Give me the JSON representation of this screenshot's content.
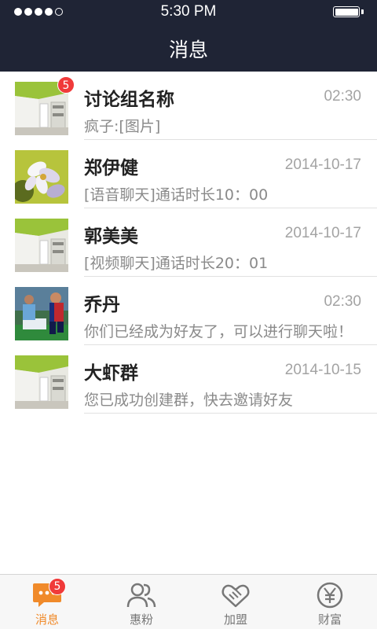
{
  "status_bar": {
    "time": "5:30 PM",
    "signal_dots_filled": 4,
    "signal_dots_total": 5,
    "battery_level": 1.0
  },
  "nav": {
    "title": "消息"
  },
  "conversations": [
    {
      "name": "讨论组名称",
      "time": "02:30",
      "preview": "疯子:[图片]",
      "badge": "5",
      "avatar_icon": "room-photo"
    },
    {
      "name": "郑伊健",
      "time": "2014-10-17",
      "preview": "[语音聊天]通话时长10：00",
      "avatar_icon": "flower-photo"
    },
    {
      "name": "郭美美",
      "time": "2014-10-17",
      "preview": "[视频聊天]通话时长20：01",
      "avatar_icon": "room-photo"
    },
    {
      "name": "乔丹",
      "time": "02:30",
      "preview": "你们已经成为好友了，可以进行聊天啦！",
      "avatar_icon": "soccer-photo"
    },
    {
      "name": "大虾群",
      "time": "2014-10-15",
      "preview": "您已成功创建群，快去邀请好友",
      "avatar_icon": "room-photo"
    }
  ],
  "tabs": [
    {
      "label": "消息",
      "icon": "chat-bubble-icon",
      "active": true,
      "badge": "5"
    },
    {
      "label": "惠粉",
      "icon": "people-icon",
      "active": false
    },
    {
      "label": "加盟",
      "icon": "handshake-icon",
      "active": false
    },
    {
      "label": "财富",
      "icon": "yen-coin-icon",
      "active": false
    }
  ],
  "colors": {
    "header_bg": "#1f2435",
    "accent": "#f08a2a",
    "badge": "#f03a3a",
    "tab_inactive": "#777777"
  }
}
